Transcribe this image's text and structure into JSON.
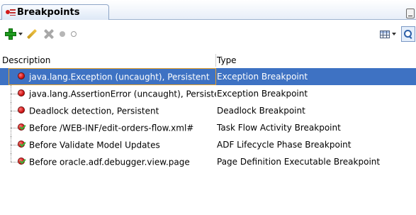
{
  "panel": {
    "tab_title": "Breakpoints"
  },
  "toolbar": {
    "add_icon": "plus-icon",
    "edit_icon": "pencil-icon",
    "delete_icon": "x-icon",
    "enable_icon": "filled-circle-icon",
    "disable_icon": "hollow-circle-icon",
    "columns_icon": "table-columns-icon",
    "find_icon": "magnifier-icon"
  },
  "table": {
    "columns": [
      "Description",
      "Type"
    ],
    "rows": [
      {
        "description": "java.lang.Exception (uncaught), Persistent",
        "type": "Exception Breakpoint",
        "icon": "breakpoint-icon",
        "selected": true
      },
      {
        "description": "java.lang.AssertionError (uncaught), Persistent",
        "type": "Exception Breakpoint",
        "icon": "breakpoint-icon",
        "selected": false
      },
      {
        "description": "Deadlock detection, Persistent",
        "type": "Deadlock Breakpoint",
        "icon": "breakpoint-icon",
        "selected": false
      },
      {
        "description": "Before /WEB-INF/edit-orders-flow.xml#",
        "type": "Task Flow Activity Breakpoint",
        "icon": "verified-breakpoint-icon",
        "selected": false
      },
      {
        "description": "Before Validate Model Updates",
        "type": "ADF Lifecycle Phase Breakpoint",
        "icon": "verified-breakpoint-icon",
        "selected": false
      },
      {
        "description": "Before oracle.adf.debugger.view.page",
        "type": "Page Definition Executable Breakpoint",
        "icon": "verified-breakpoint-icon",
        "selected": false
      }
    ]
  },
  "colors": {
    "selection": "#3e72c3",
    "breakpoint_red": "#d21414",
    "add_green": "#1e9a1e"
  }
}
